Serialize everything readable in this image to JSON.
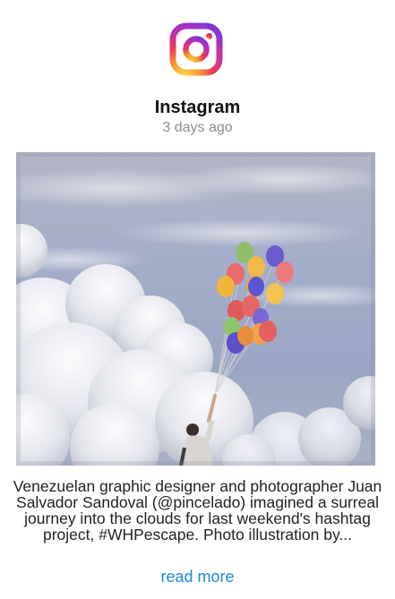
{
  "post": {
    "source": "Instagram",
    "time_ago": "3 days ago",
    "caption": "Venezuelan graphic designer and photographer Juan Salvador Sandoval (@pincelado) imagined a surreal journey into the clouds for last weekend's hashtag project, #WHPescape. Photo illustration by...",
    "read_more_label": "read more",
    "logo_icon": "instagram-logo-icon",
    "image_subject": "person holding colorful balloons in cloudy sky"
  },
  "colors": {
    "link": "#1a8bd6",
    "timestamp": "#8e8e8e",
    "sky": "#9fa9c3",
    "logo_gradient": [
      "#f9c13b",
      "#e9405a",
      "#b12fbc",
      "#7a3bd8"
    ]
  }
}
